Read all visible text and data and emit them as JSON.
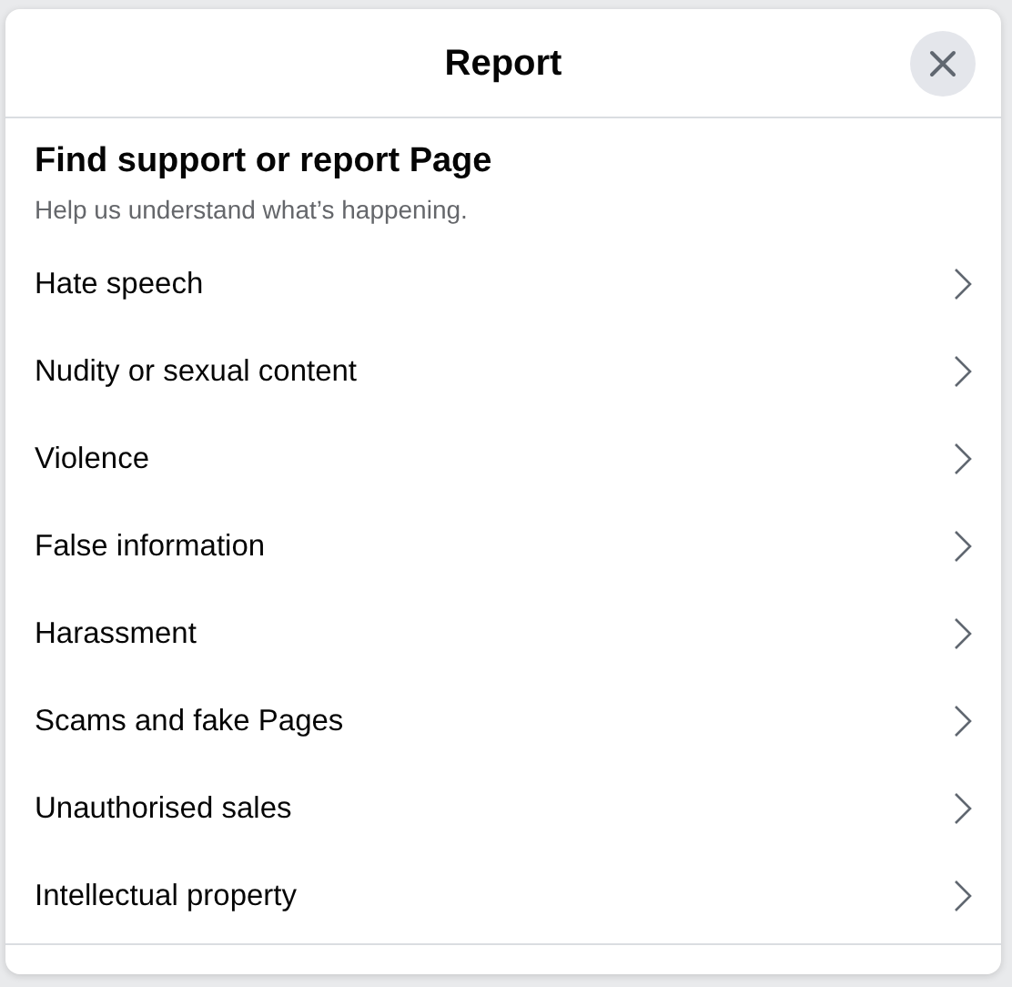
{
  "dialog": {
    "title": "Report"
  },
  "heading": "Find support or report Page",
  "subheading": "Help us understand what’s happening.",
  "options": [
    {
      "label": "Hate speech"
    },
    {
      "label": "Nudity or sexual content"
    },
    {
      "label": "Violence"
    },
    {
      "label": "False information"
    },
    {
      "label": "Harassment"
    },
    {
      "label": "Scams and fake Pages"
    },
    {
      "label": "Unauthorised sales"
    },
    {
      "label": "Intellectual property"
    }
  ]
}
